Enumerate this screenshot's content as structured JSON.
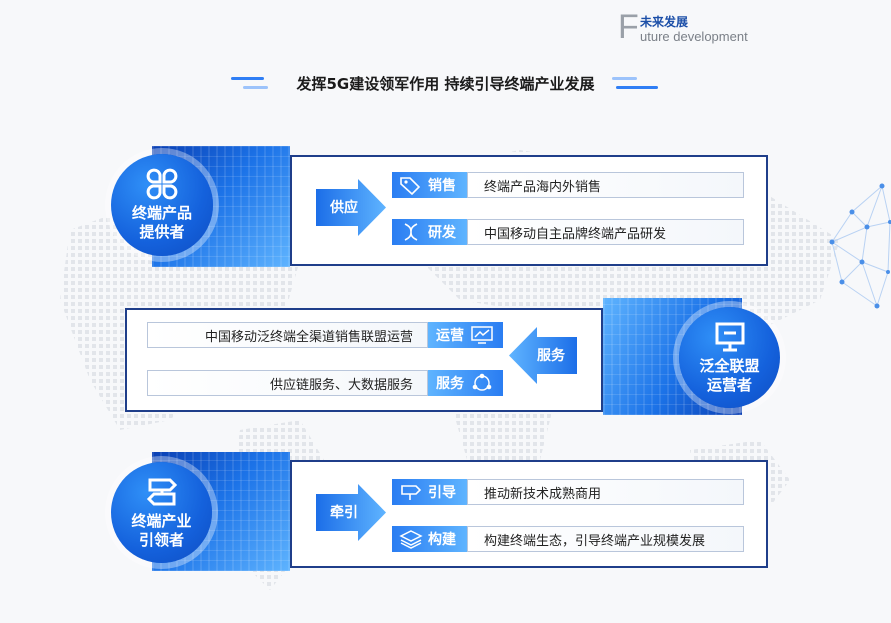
{
  "header": {
    "brand_letter": "F",
    "brand_zh": "未来发展",
    "brand_en": "uture development"
  },
  "title": "发挥5G建设领军作用  持续引导终端产业发展",
  "sections": [
    {
      "role": "终端产品提供者",
      "role_line1": "终端产品",
      "role_line2": "提供者",
      "role_icon": "clover-grid-icon",
      "arrow_label": "供应",
      "items": [
        {
          "tag": "销售",
          "icon": "price-tag-icon",
          "text": "终端产品海内外销售"
        },
        {
          "tag": "研发",
          "icon": "dna-icon",
          "text": "中国移动自主品牌终端产品研发"
        }
      ]
    },
    {
      "role": "泛全联盟运营者",
      "role_line1": "泛全联盟",
      "role_line2": "运营者",
      "role_icon": "monitor-icon",
      "arrow_label": "服务",
      "items": [
        {
          "tag": "运营",
          "icon": "chart-screen-icon",
          "text": "中国移动泛终端全渠道销售联盟运营"
        },
        {
          "tag": "服务",
          "icon": "network-cycle-icon",
          "text": "供应链服务、大数据服务"
        }
      ]
    },
    {
      "role": "终端产业引领者",
      "role_line1": "终端产业",
      "role_line2": "引领者",
      "role_icon": "signpost-icon",
      "arrow_label": "牵引",
      "items": [
        {
          "tag": "引导",
          "icon": "direction-sign-icon",
          "text": "推动新技术成熟商用"
        },
        {
          "tag": "构建",
          "icon": "layers-icon",
          "text": "构建终端生态，引导终端产业规模发展"
        }
      ]
    }
  ],
  "colors": {
    "frame": "#1f3e8a",
    "accent": "#1461dc",
    "accent_light": "#5fb4ff"
  }
}
